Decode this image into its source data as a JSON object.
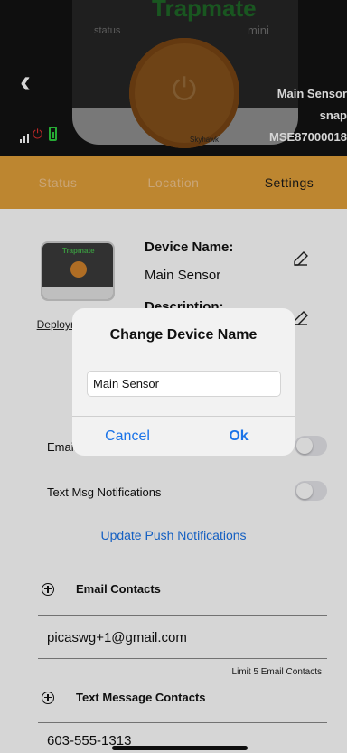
{
  "colors": {
    "accent": "#E2A03A",
    "link": "#1A73E8",
    "battery": "#2ECC40",
    "power": "#E03030"
  },
  "header": {
    "back_icon": "chevron-left-icon",
    "device_brand": "Trapmate",
    "device_model": "mini",
    "device_status": "status",
    "device_label": "Main Sensor",
    "device_sub": "snap",
    "device_serial": "MSE87000018",
    "device_small": "Skyhawk"
  },
  "tabs": [
    {
      "label": "Status"
    },
    {
      "label": "Location"
    },
    {
      "label": "Settings"
    }
  ],
  "settings": {
    "thumb_brand": "Trapmate",
    "deploy_text": "Deployment Photo",
    "device_name_label": "Device Name:",
    "device_name_value": "Main Sensor",
    "description_label": "Description:",
    "email_notifications_label": "Email Notifications",
    "text_notifications_label": "Text Msg Notifications",
    "update_push_link": "Update Push Notifications",
    "email_contacts_label": "Email Contacts",
    "email_contact": "picaswg+1@gmail.com",
    "email_limit": "Limit 5 Email Contacts",
    "text_contacts_label": "Text Message Contacts",
    "text_contact": "603-555-1313"
  },
  "dialog": {
    "title": "Change Device Name",
    "input_value": "Main Sensor",
    "cancel_label": "Cancel",
    "ok_label": "Ok"
  }
}
